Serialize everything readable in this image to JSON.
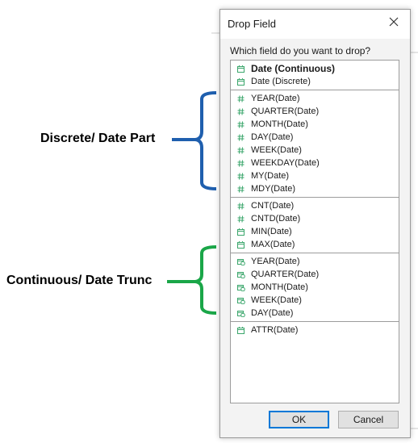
{
  "dialog": {
    "title": "Drop Field",
    "prompt": "Which field do you want to drop?",
    "ok_label": "OK",
    "cancel_label": "Cancel"
  },
  "groups": [
    {
      "items": [
        {
          "label": "Date (Continuous)",
          "icon": "calendar-icon",
          "bold": true
        },
        {
          "label": "Date (Discrete)",
          "icon": "calendar-icon",
          "bold": false
        }
      ]
    },
    {
      "items": [
        {
          "label": "YEAR(Date)",
          "icon": "hash-icon"
        },
        {
          "label": "QUARTER(Date)",
          "icon": "hash-icon"
        },
        {
          "label": "MONTH(Date)",
          "icon": "hash-icon"
        },
        {
          "label": "DAY(Date)",
          "icon": "hash-icon"
        },
        {
          "label": "WEEK(Date)",
          "icon": "hash-icon"
        },
        {
          "label": "WEEKDAY(Date)",
          "icon": "hash-icon"
        },
        {
          "label": "MY(Date)",
          "icon": "hash-icon"
        },
        {
          "label": "MDY(Date)",
          "icon": "hash-icon"
        }
      ]
    },
    {
      "items": [
        {
          "label": "CNT(Date)",
          "icon": "hash-icon"
        },
        {
          "label": "CNTD(Date)",
          "icon": "hash-icon"
        },
        {
          "label": "MIN(Date)",
          "icon": "calendar-icon"
        },
        {
          "label": "MAX(Date)",
          "icon": "calendar-icon"
        }
      ]
    },
    {
      "items": [
        {
          "label": "YEAR(Date)",
          "icon": "calendar-clock-icon"
        },
        {
          "label": "QUARTER(Date)",
          "icon": "calendar-clock-icon"
        },
        {
          "label": "MONTH(Date)",
          "icon": "calendar-clock-icon"
        },
        {
          "label": "WEEK(Date)",
          "icon": "calendar-clock-icon"
        },
        {
          "label": "DAY(Date)",
          "icon": "calendar-clock-icon"
        }
      ]
    },
    {
      "items": [
        {
          "label": "ATTR(Date)",
          "icon": "calendar-icon"
        }
      ]
    }
  ],
  "annotations": {
    "discrete": {
      "label": "Discrete/ Date Part",
      "color": "#1f5fae"
    },
    "continuous": {
      "label": "Continuous/ Date Trunc",
      "color": "#1aa648"
    }
  },
  "colors": {
    "icon_green": "#3aa66b",
    "accent": "#0078d7"
  }
}
